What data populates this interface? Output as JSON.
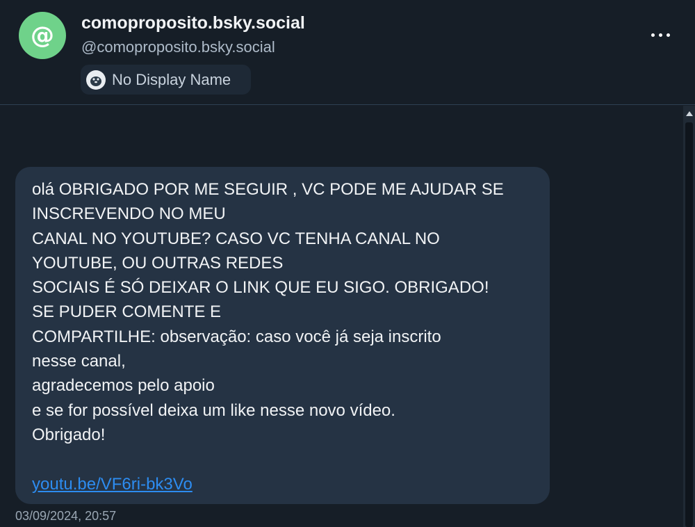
{
  "profile": {
    "avatar_symbol": "@",
    "avatar_color": "#6fd28a",
    "title": "comoproposito.bsky.social",
    "handle": "@comoproposito.bsky.social",
    "display_name_pill": {
      "icon": "seal-icon",
      "label": "No Display Name"
    },
    "more_menu_icon": "more-options-icon"
  },
  "message": {
    "lines": [
      "olá OBRIGADO POR ME SEGUIR , VC PODE ME AJUDAR SE",
      "INSCREVENDO NO MEU",
      "CANAL NO YOUTUBE? CASO VC TENHA CANAL NO",
      "YOUTUBE, OU OUTRAS REDES",
      "SOCIAIS É SÓ DEIXAR O LINK QUE EU SIGO. OBRIGADO!",
      "SE PUDER COMENTE E",
      "COMPARTILHE: observação: caso você já seja inscrito",
      "nesse canal,",
      "agradecemos pelo apoio",
      "e se for possível deixa um like nesse novo vídeo.",
      "Obrigado!"
    ],
    "link": "youtu.be/VF6ri-bk3Vo",
    "timestamp": "03/09/2024, 20:57"
  },
  "colors": {
    "background": "#161e27",
    "bubble": "#253344",
    "link": "#2d8cf0",
    "muted_text": "#aebbc9"
  }
}
